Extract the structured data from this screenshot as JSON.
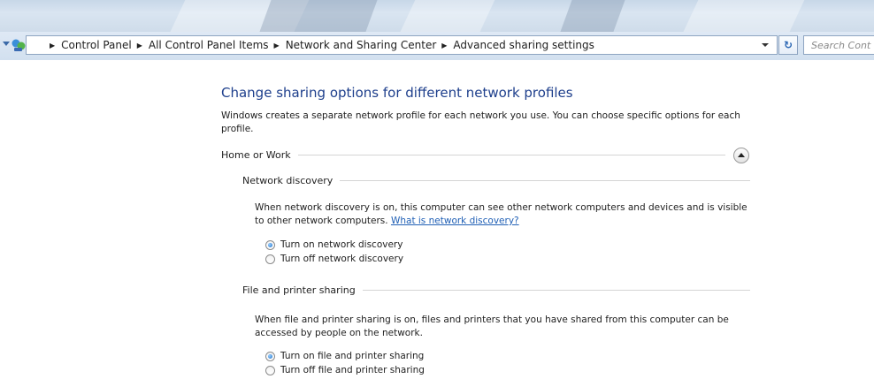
{
  "breadcrumb": {
    "items": [
      "Control Panel",
      "All Control Panel Items",
      "Network and Sharing Center",
      "Advanced sharing settings"
    ]
  },
  "search": {
    "placeholder": "Search Control Panel",
    "visible_text": "Search Cont"
  },
  "page": {
    "title": "Change sharing options for different network profiles",
    "intro": "Windows creates a separate network profile for each network you use. You can choose specific options for each profile."
  },
  "profile": {
    "name": "Home or Work",
    "state": "expanded"
  },
  "network_discovery": {
    "heading": "Network discovery",
    "description": "When network discovery is on, this computer can see other network computers and devices and is visible to other network computers.",
    "link": "What is network discovery?",
    "options": [
      {
        "label": "Turn on network discovery",
        "selected": true
      },
      {
        "label": "Turn off network discovery",
        "selected": false
      }
    ]
  },
  "file_printer_sharing": {
    "heading": "File and printer sharing",
    "description": "When file and printer sharing is on, files and printers that you have shared from this computer can be accessed by people on the network.",
    "options": [
      {
        "label": "Turn on file and printer sharing",
        "selected": true
      },
      {
        "label": "Turn off file and printer sharing",
        "selected": false
      }
    ]
  },
  "icons": [
    "nav-dropdown-icon",
    "control-panel-icon",
    "breadcrumb-arrow-icon",
    "address-dropdown-icon",
    "refresh-icon",
    "collapse-chevron-icon"
  ],
  "colors": {
    "title": "#1e3f8c",
    "link": "#1f5fb5",
    "radio_selected": "#1d6fc7"
  }
}
